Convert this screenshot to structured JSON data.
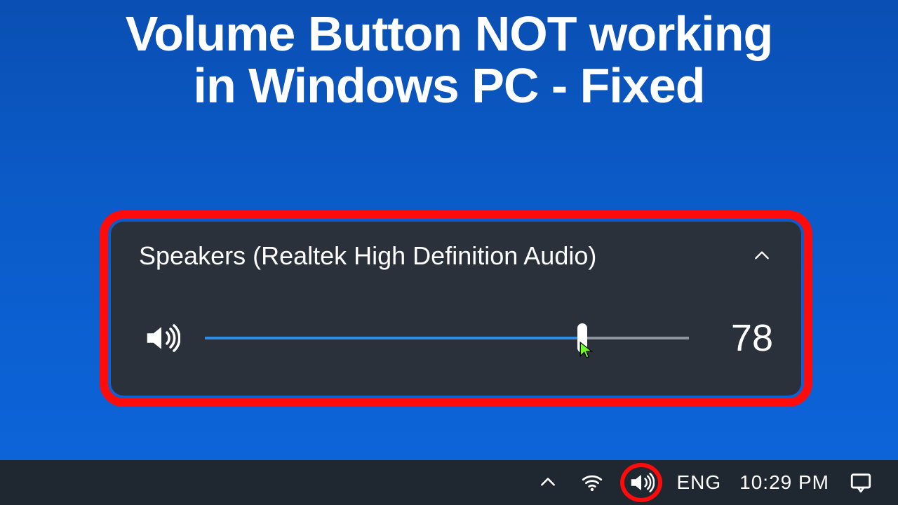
{
  "headline": {
    "line1": "Volume Button NOT working",
    "line2": "in Windows PC - Fixed"
  },
  "flyout": {
    "device_name": "Speakers (Realtek High Definition Audio)",
    "volume_value": "78",
    "volume_percent": 78
  },
  "taskbar": {
    "language": "ENG",
    "time": "10:29 PM"
  },
  "colors": {
    "highlight": "#ff0b0b",
    "panel_bg": "#2b313b",
    "slider_fill": "#2e8ee6"
  }
}
